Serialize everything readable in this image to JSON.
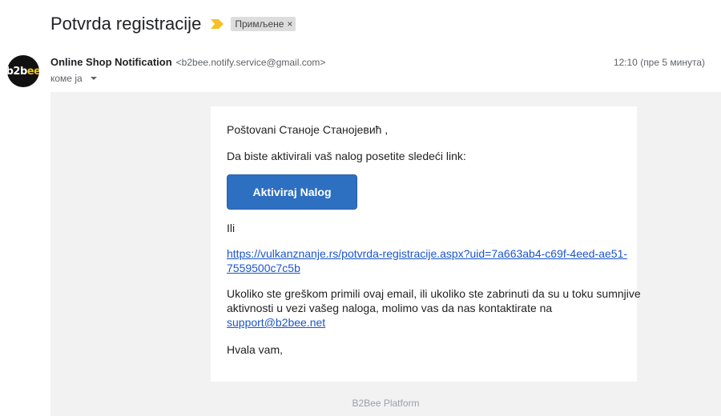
{
  "subject": "Potvrda registracije",
  "label": "Примљене",
  "label_close": "×",
  "avatar_text": {
    "b1": "b2b",
    "b2": "ee"
  },
  "sender": {
    "name": "Online Shop Notification",
    "email": "<b2bee.notify.service@gmail.com>",
    "to": "коме ја",
    "time": "12:10 (пре 5 минута)"
  },
  "body": {
    "greeting": "Poštovani Станоје Станојевић ,",
    "intro": "Da biste aktivirali vaš nalog posetite sledeći link:",
    "button_label": "Aktiviraj Nalog",
    "or_text": "Ili",
    "link_line1": "https://vulkanznanje.rs/potvrda-registracije.aspx?uid=7a663ab4-c69f-4eed-ae51-",
    "link_line2": "7559500c7c5b",
    "warning_line1": "Ukoliko ste greškom primili ovaj email, ili ukoliko ste zabrinuti da su u toku sumnjive",
    "warning_line2": "aktivnosti u vezi vašeg naloga, molimo vas da nas kontaktirate na",
    "support_email": "support@b2bee.net",
    "thanks": "Hvala vam,"
  },
  "footer": "B2Bee Platform",
  "colors": {
    "button": "#2d6fc1",
    "link": "#1a55cc",
    "importance": "#f6c026"
  },
  "icons": {
    "importance": "importance-marker-icon",
    "caret": "chevron-down-icon"
  }
}
